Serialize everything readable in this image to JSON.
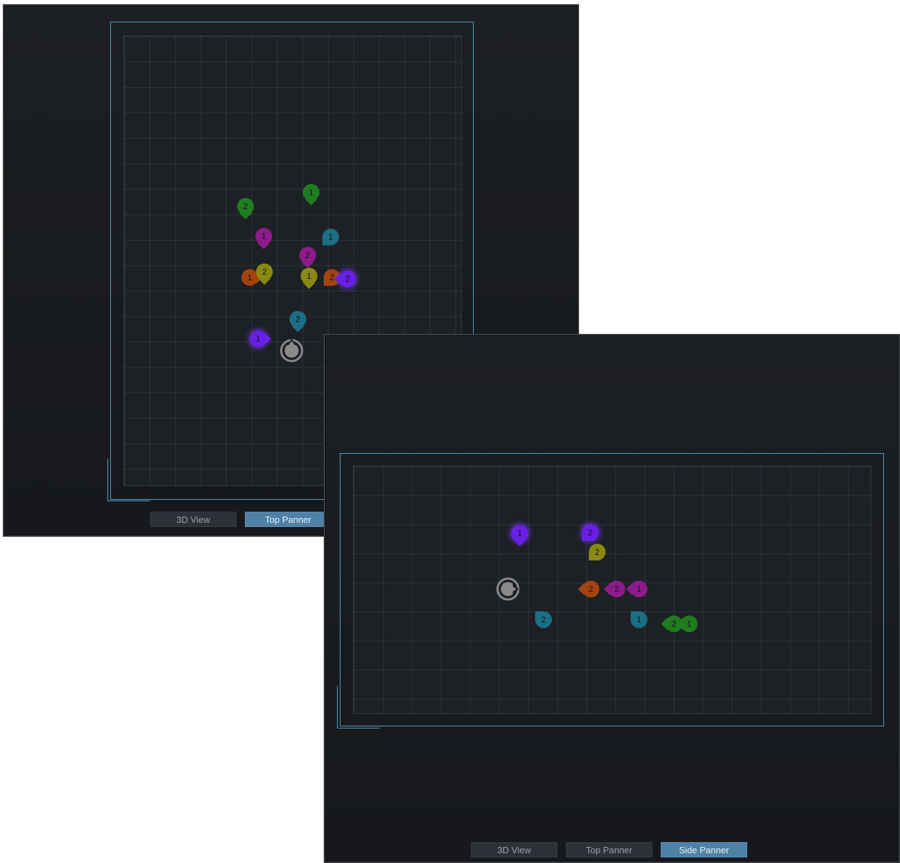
{
  "colors": {
    "green": "#1f7d1f",
    "teal": "#1c6e84",
    "magenta": "#8c1c8c",
    "orange": "#a4430f",
    "olive": "#8a8a12",
    "violet": "#6a1fe6",
    "frame": "#4fa3c8",
    "listener": "#8a8a8a"
  },
  "top_window": {
    "tabs": [
      {
        "label": "3D View",
        "active": false
      },
      {
        "label": "Top Panner",
        "active": true
      }
    ],
    "listener_icon": "listener-head-icon",
    "markers": [
      {
        "label": "1",
        "color": "green"
      },
      {
        "label": "2",
        "color": "green"
      },
      {
        "label": "1",
        "color": "magenta"
      },
      {
        "label": "1",
        "color": "teal"
      },
      {
        "label": "2",
        "color": "magenta"
      },
      {
        "label": "1",
        "color": "orange"
      },
      {
        "label": "2",
        "color": "olive"
      },
      {
        "label": "1",
        "color": "olive"
      },
      {
        "label": "2",
        "color": "orange"
      },
      {
        "label": "2",
        "color": "violet"
      },
      {
        "label": "2",
        "color": "teal"
      },
      {
        "label": "1",
        "color": "violet"
      }
    ]
  },
  "side_window": {
    "tabs": [
      {
        "label": "3D View",
        "active": false
      },
      {
        "label": "Top Panner",
        "active": false
      },
      {
        "label": "Side Panner",
        "active": true
      }
    ],
    "listener_icon": "listener-head-icon",
    "markers": [
      {
        "label": "1",
        "color": "violet"
      },
      {
        "label": "2",
        "color": "violet"
      },
      {
        "label": "2",
        "color": "olive"
      },
      {
        "label": "2",
        "color": "orange"
      },
      {
        "label": "2",
        "color": "magenta"
      },
      {
        "label": "1",
        "color": "magenta"
      },
      {
        "label": "2",
        "color": "teal"
      },
      {
        "label": "1",
        "color": "teal"
      },
      {
        "label": "2",
        "color": "green"
      },
      {
        "label": "1",
        "color": "green"
      }
    ]
  }
}
